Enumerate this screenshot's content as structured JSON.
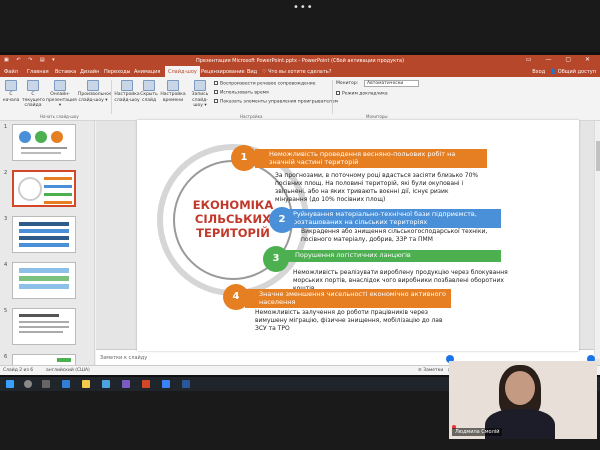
{
  "zoom": {
    "menu_dots": "•••"
  },
  "window": {
    "title": "Презентация Microsoft PowerPoint.pptx - PowerPoint (Сбой активации продукта)",
    "quick_access": "▣ ↶ ↷ ▤ ▾",
    "controls": "▭ — ▢ ✕"
  },
  "menu": {
    "tabs": [
      "Файл",
      "Главная",
      "Вставка",
      "Дизайн",
      "Переходы",
      "Анимация",
      "Слайд-шоу",
      "Рецензирование",
      "Вид"
    ],
    "active_tab": "Слайд-шоу",
    "search": "♡ Что вы хотите сделать?",
    "login": "Вход",
    "share": "Общий доступ"
  },
  "ribbon": {
    "buttons": [
      {
        "label": "С начала"
      },
      {
        "label": "С текущего слайда"
      },
      {
        "label": "Онлайн-презентация ▾"
      },
      {
        "label": "Произвольное слайд-шоу ▾"
      },
      {
        "label": "Настройка слайд-шоу"
      },
      {
        "label": "Скрыть слайд"
      },
      {
        "label": "Настройка времени"
      },
      {
        "label": "Запись слайд-шоу ▾"
      }
    ],
    "checkboxes": [
      "Воспроизвести речевое сопровождение",
      "Использовать время",
      "Показать элементы управления проигрывателем"
    ],
    "monitor_label": "Монитор:",
    "monitor_value": "Автоматически",
    "presenter_view": "Режим докладчика",
    "groups": {
      "start": "Начать слайд-шоу",
      "setup": "Настройка",
      "monitors": "Мониторы"
    }
  },
  "thumbnails": [
    {
      "num": "1"
    },
    {
      "num": "2"
    },
    {
      "num": "3"
    },
    {
      "num": "4"
    },
    {
      "num": "5"
    },
    {
      "num": "6"
    }
  ],
  "slide": {
    "center_title": [
      "ЕКОНОМІКА",
      "СІЛЬСЬКИХ",
      "ТЕРИТОРІЙ"
    ],
    "items": [
      {
        "num": "1",
        "title": "Неможливість проведення весняно-польових робіт на значній частині територій",
        "desc": "За прогнозами, в поточному році вдасться засіяти близько 70% посівних площ. На половині територій, які були окуповані і звільнені, або на яких тривають воєнні дії, існує ризик мінування (до 10% посівних площ)"
      },
      {
        "num": "2",
        "title": "Руйнування матеріально-технічної бази підприємств, розташованих на сільських територіях",
        "desc": "Викрадення або знищення сільськогосподарської техніки, посівного матеріалу, добрив, ЗЗР та ПММ"
      },
      {
        "num": "3",
        "title": "Порушення логістичних ланцюгів",
        "desc": "Неможливість реалізувати вироблену продукцію через блокування морських портів, внаслідок чого виробники позбавлені оборотних коштів"
      },
      {
        "num": "4",
        "title": "Значне зменшення чисельності економічно активного населення",
        "desc": "Неможливість залучення до роботи  працівників через вимушену міграцію, фізичне знищення, мобілізацію до   лав ЗСУ та ТРО"
      }
    ]
  },
  "notes": {
    "placeholder": "Заметки к слайду"
  },
  "status": {
    "slide_info": "Слайд 2 из 6",
    "language": "английский (США)",
    "notes_btn": "≡ Заметки",
    "comments_btn": "▤ Примечания",
    "zoom": "⊟  —————  ⊞"
  },
  "participant": {
    "name": "Людмила Смолій"
  },
  "colors": {
    "ppt_accent": "#b7472a",
    "orange": "#e67e22",
    "blue": "#4a90d9",
    "green": "#4caf50",
    "title_red": "#c0392b"
  }
}
